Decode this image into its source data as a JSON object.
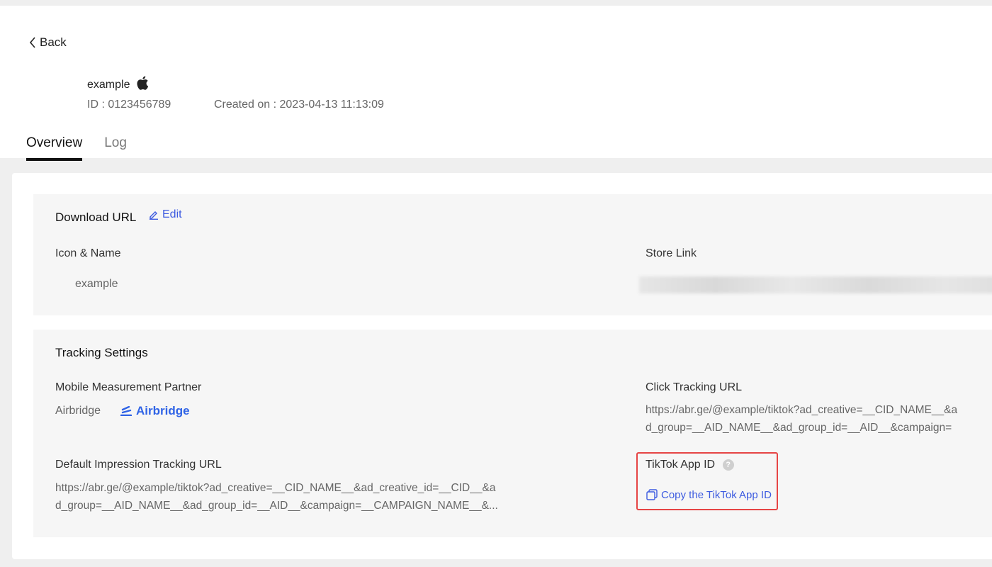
{
  "nav": {
    "back_label": "Back"
  },
  "app": {
    "name": "example",
    "platform_icon": "apple-icon",
    "id_text": "ID : 0123456789",
    "created_text": "Created on : 2023-04-13 11:13:09"
  },
  "tabs": [
    {
      "label": "Overview",
      "active": true
    },
    {
      "label": "Log",
      "active": false
    }
  ],
  "download": {
    "title": "Download URL",
    "edit_label": "Edit",
    "icon_name_label": "Icon & Name",
    "icon_name_value": "example",
    "store_link_label": "Store Link"
  },
  "tracking": {
    "title": "Tracking Settings",
    "mmp_label": "Mobile Measurement Partner",
    "mmp_value": "Airbridge",
    "mmp_logo_text": "Airbridge",
    "click_label": "Click Tracking URL",
    "click_url_line1": "https://abr.ge/@example/tiktok?ad_creative=__CID_NAME__&a",
    "click_url_line2": "d_group=__AID_NAME__&ad_group_id=__AID__&campaign=",
    "impression_label": "Default Impression Tracking URL",
    "impression_url_line1": "https://abr.ge/@example/tiktok?ad_creative=__CID_NAME__&ad_creative_id=__CID__&a",
    "impression_url_line2": "d_group=__AID_NAME__&ad_group_id=__AID__&campaign=__CAMPAIGN_NAME__&...",
    "tiktok_app_id_label": "TikTok App ID",
    "help_glyph": "?",
    "copy_label": "Copy the TikTok App ID"
  },
  "colors": {
    "accent": "#3d5be0",
    "airbridge": "#2f63e6",
    "highlight": "#e64545",
    "panel_bg": "#f6f6f6"
  }
}
